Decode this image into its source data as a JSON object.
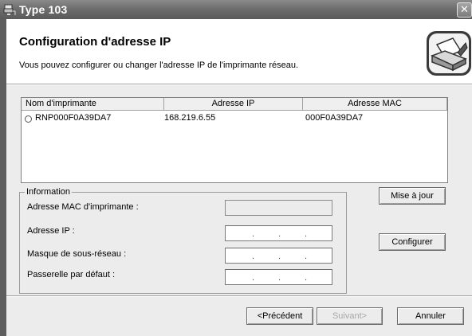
{
  "window": {
    "title": "Type 103",
    "close_glyph": "✕"
  },
  "header": {
    "title": "Configuration d'adresse IP",
    "subtitle": "Vous pouvez configurer ou changer l'adresse IP de l'imprimante réseau."
  },
  "printer_list": {
    "columns": [
      "Nom d'imprimante",
      "Adresse IP",
      "Adresse MAC"
    ],
    "rows": [
      {
        "name": "RNP000F0A39DA7",
        "ip": "168.219.6.55",
        "mac": "000F0A39DA7"
      }
    ]
  },
  "information": {
    "legend": "Information",
    "mac_label": "Adresse MAC d'imprimante :",
    "mac_value": "",
    "ip_label": "Adresse IP :",
    "subnet_label": "Masque de sous-réseau :",
    "gateway_label": "Passerelle par défaut :",
    "ip_separator": "."
  },
  "buttons": {
    "refresh": "Mise à jour",
    "configure": "Configurer",
    "previous": "<Précédent",
    "next": "Suivant>",
    "cancel": "Annuler",
    "next_enabled": false
  },
  "icons": {
    "app": "printer-network-icon",
    "header": "printer-icon"
  },
  "colors": {
    "titlebar": "#6e6e6e",
    "dialog_bg": "#ececec",
    "header_bg": "#ffffff"
  }
}
